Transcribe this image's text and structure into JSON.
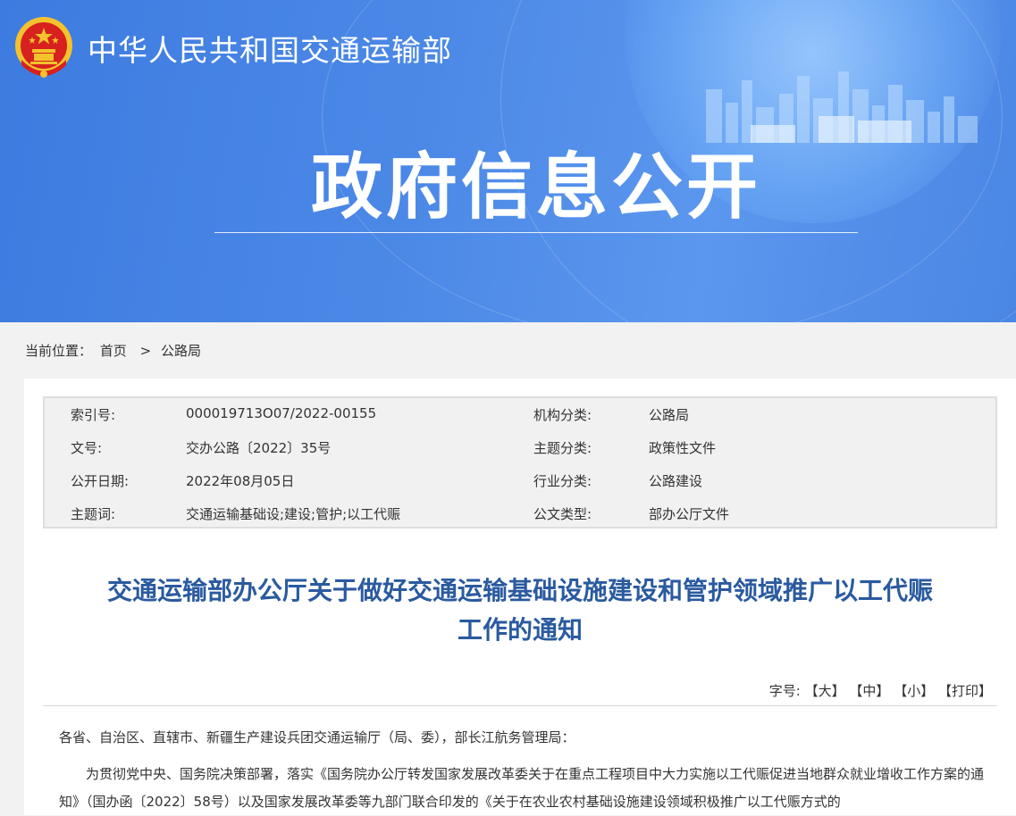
{
  "header": {
    "site_title": "中华人民共和国交通运输部",
    "banner_heading": "政府信息公开"
  },
  "breadcrumb": {
    "label": "当前位置：",
    "home": "首页",
    "separator": ">",
    "current": "公路局"
  },
  "meta": {
    "rows": [
      {
        "k1": "索引号:",
        "v1": "000019713O07/2022-00155",
        "k2": "机构分类:",
        "v2": "公路局"
      },
      {
        "k1": "文号:",
        "v1": "交办公路〔2022〕35号",
        "k2": "主题分类:",
        "v2": "政策性文件"
      },
      {
        "k1": "公开日期:",
        "v1": "2022年08月05日",
        "k2": "行业分类:",
        "v2": "公路建设"
      },
      {
        "k1": "主题词:",
        "v1": "交通运输基础设;建设;管护;以工代赈",
        "k2": "公文类型:",
        "v2": "部办公厅文件"
      }
    ]
  },
  "document": {
    "title_line1": "交通运输部办公厅关于做好交通运输基础设施建设和管护领域推广以工代赈",
    "title_line2": "工作的通知",
    "addressee": "各省、自治区、直辖市、新疆生产建设兵团交通运输厅（局、委），部长江航务管理局：",
    "paragraph1": "为贯彻党中央、国务院决策部署，落实《国务院办公厅转发国家发展改革委关于在重点工程项目中大力实施以工代赈促进当地群众就业增收工作方案的通知》（国办函〔2022〕58号）以及国家发展改革委等九部门联合印发的《关于在农业农村基础设施建设领域积极推广以工代赈方式的"
  },
  "font_tools": {
    "label": "字号:",
    "large": "【大】",
    "medium": "【中】",
    "small": "【小】",
    "print": "【打印】"
  },
  "colors": {
    "banner_blue": "#4a86e4",
    "title_blue": "#2a5a9f",
    "emblem_red": "#d6211f",
    "emblem_gold": "#f3c22c"
  },
  "icons": {
    "emblem": "national-emblem-icon"
  }
}
